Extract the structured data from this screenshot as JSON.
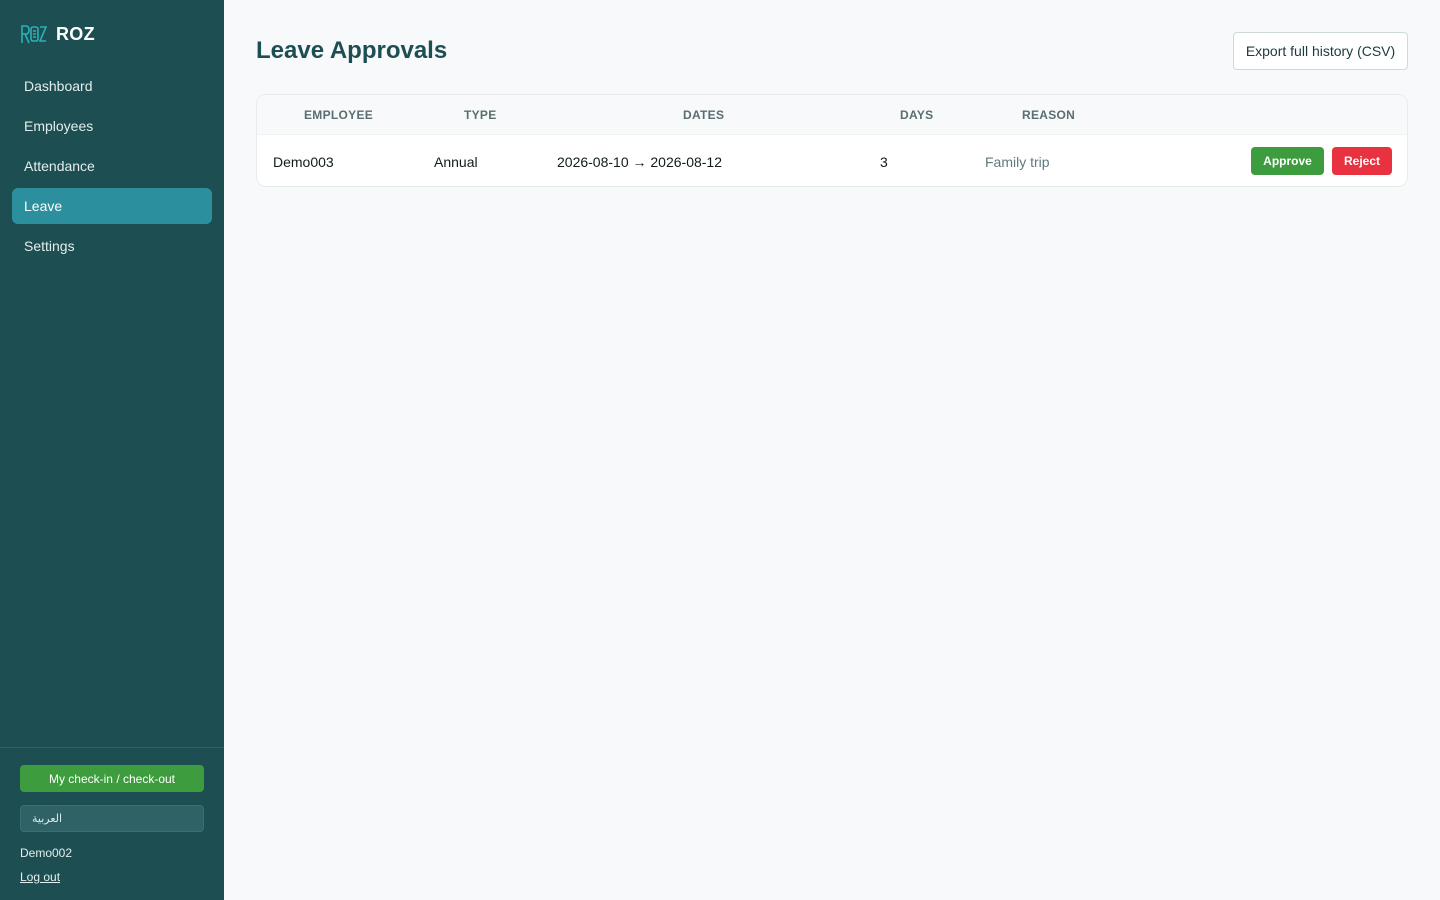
{
  "app": {
    "brand_name": "ROZ",
    "logo_icon": "roz-logo-icon",
    "colors": {
      "sidebar_bg": "#1d4e52",
      "active_nav": "#2b8f9d",
      "approve": "#3d9c3d",
      "reject": "#e8323f",
      "title": "#1d4e52"
    }
  },
  "sidebar": {
    "items": [
      {
        "label": "Dashboard",
        "active": false
      },
      {
        "label": "Employees",
        "active": false
      },
      {
        "label": "Attendance",
        "active": false
      },
      {
        "label": "Leave",
        "active": true
      },
      {
        "label": "Settings",
        "active": false
      }
    ],
    "checkin_label": "My check-in / check-out",
    "language_value": "العربية",
    "user_name": "Demo002",
    "logout_label": "Log out"
  },
  "main": {
    "title": "Leave Approvals",
    "export_label": "Export full history (CSV)",
    "table": {
      "headers": [
        "Employee",
        "Type",
        "Dates",
        "Days",
        "Reason"
      ],
      "rows": [
        {
          "employee": "Demo003",
          "type": "Annual",
          "dates": "2026-08-10 → 2026-08-12",
          "days": "3",
          "reason": "Family trip",
          "approve_label": "Approve",
          "reject_label": "Reject"
        }
      ]
    }
  }
}
